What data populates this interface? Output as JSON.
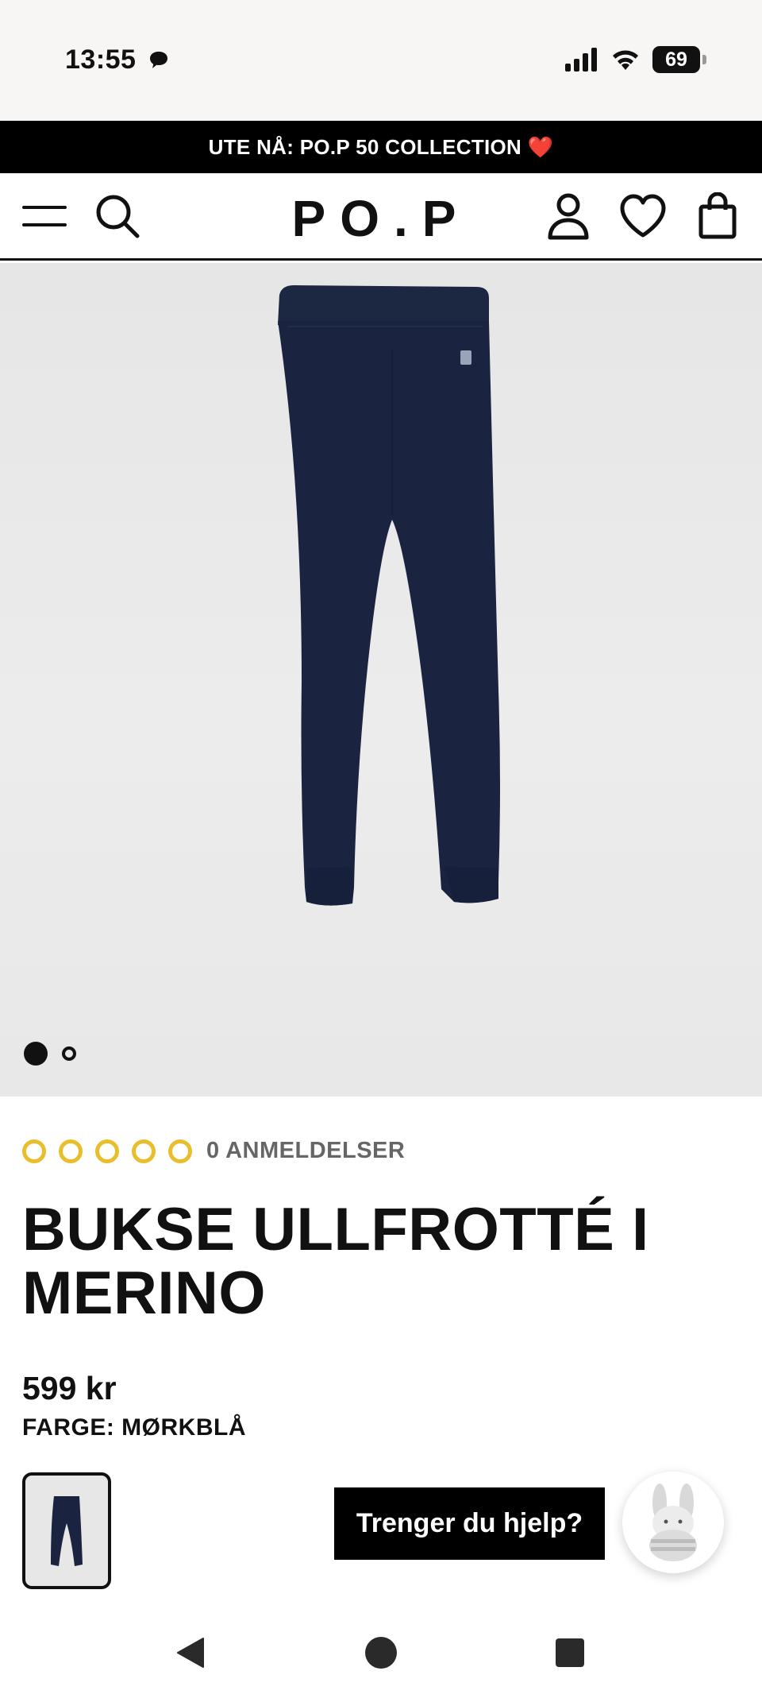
{
  "status": {
    "time": "13:55",
    "battery": "69"
  },
  "promo": {
    "text": "UTE NÅ: PO.P 50 COLLECTION ❤️"
  },
  "header": {
    "logo": "PO.P",
    "icons": [
      "menu-icon",
      "search-icon",
      "account-icon",
      "heart-icon",
      "bag-icon"
    ]
  },
  "gallery": {
    "image_count": 2,
    "active_index": 0
  },
  "product": {
    "rating_stars": 0,
    "rating_max": 5,
    "reviews_label": "0 ANMELDELSER",
    "title": "BUKSE ULLFROTTÉ I MERINO",
    "price": "599 kr",
    "color_label": "FARGE: MØRKBLÅ"
  },
  "help": {
    "button_label": "Trenger du hjelp?"
  },
  "colors": {
    "accent_star": "#e9bd2b",
    "pants": "#1a2440",
    "banner": "#000000"
  }
}
